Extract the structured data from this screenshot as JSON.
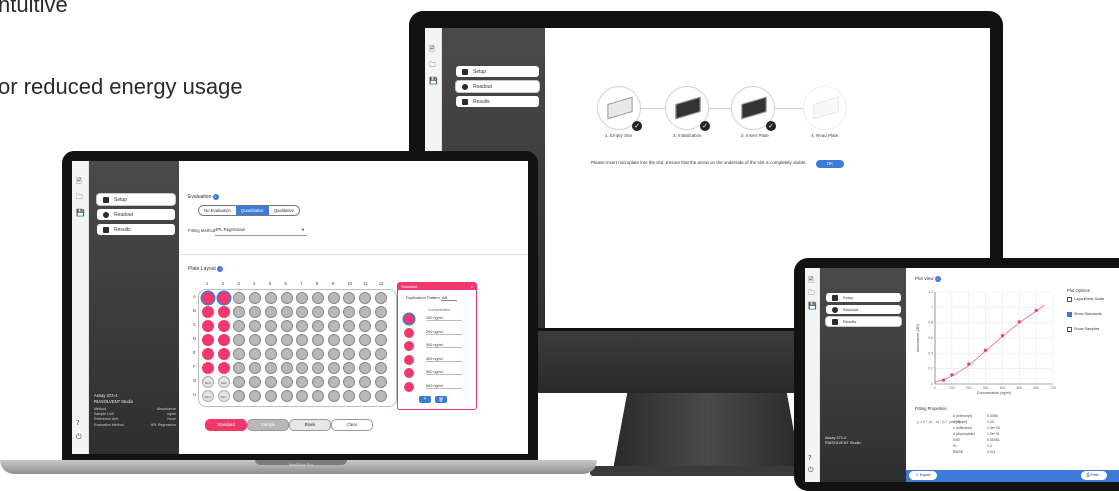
{
  "marketing": {
    "line1": "ntuitive",
    "line2": "or reduced energy usage"
  },
  "app": {
    "nav_items": [
      "Setup",
      "Readout",
      "Results"
    ],
    "info_panel": {
      "assay": "Assay 372-4",
      "software": "RIASOLVENT Studio",
      "rows": [
        {
          "label": "Method",
          "value": "Absorbance"
        },
        {
          "label": "Sample Unit",
          "value": "ng/ml"
        },
        {
          "label": "Reference Unit",
          "value": "None"
        },
        {
          "label": "Evaluation Method",
          "value": "4PL Regression"
        }
      ]
    }
  },
  "imac": {
    "steps": [
      "1. Empty Slot",
      "2. Initialization",
      "3. Insert Plate",
      "4. Read Plate"
    ],
    "instruction": "Please insert microplate into the slot. Ensure that the arrow on the underside of the slot is completely visible.",
    "ok_label": "OK"
  },
  "macbook": {
    "evaluation_title": "Evaluation",
    "evaluation_options": [
      "No Evaluation",
      "Quantitative",
      "Qualitative"
    ],
    "evaluation_selected": 1,
    "fitting_label": "Fitting Method",
    "fitting_value": "4PL Regression",
    "plate_title": "Plate Layout",
    "columns": [
      "1",
      "2",
      "3",
      "4",
      "5",
      "6",
      "7",
      "8",
      "9",
      "10",
      "11",
      "12"
    ],
    "rows": [
      "A",
      "B",
      "C",
      "D",
      "E",
      "F",
      "G",
      "H"
    ],
    "blank_label": "BLK",
    "std_label": "St",
    "popup": {
      "title": "Standard",
      "duplication_label": "Duplication Pattern",
      "duplication_value": "AB",
      "concentration_header": "Concentration",
      "entries": [
        "100 ng/ml",
        "200 ng/ml",
        "300 ng/ml",
        "400 ng/ml",
        "500 ng/ml",
        "600 ng/ml"
      ]
    },
    "bottom_buttons": [
      "Standard",
      "Sample",
      "Blank",
      "Clear"
    ],
    "device_label": "MacBook Pro"
  },
  "ipad": {
    "plot_title": "Plot View",
    "plot_options_title": "Plot Options",
    "options": [
      {
        "label": "Logarithmic Scale",
        "checked": false
      },
      {
        "label": "Show Standards",
        "checked": true
      },
      {
        "label": "Show Samples",
        "checked": false
      }
    ],
    "x_label": "Concentration (ng/ml)",
    "y_label": "Absorbance (OD)",
    "fit_title": "Fitting Properties",
    "fit_rows": [
      {
        "k": "a (Intercept)",
        "v": "0.0356"
      },
      {
        "k": "b (Slope)",
        "v": "1.03"
      },
      {
        "k": "c (Inflection)",
        "v": "1.3e+03"
      },
      {
        "k": "d (Asymptote)",
        "v": "1.0e+01"
      },
      {
        "k": "SSE",
        "v": "0.00051"
      },
      {
        "k": "R²",
        "v": "1.0"
      },
      {
        "k": "RMSE",
        "v": "0.011"
      }
    ],
    "export_label": "Export",
    "print_label": "Print..."
  },
  "chart_data": {
    "type": "scatter",
    "xlabel": "Concentration (ng/ml)",
    "ylabel": "Absorbance (OD)",
    "xlim": [
      0,
      700
    ],
    "ylim": [
      0,
      1.2
    ],
    "x_ticks": [
      0,
      100,
      200,
      300,
      400,
      500,
      600,
      700
    ],
    "y_ticks": [
      0,
      0.2,
      0.4,
      0.6,
      0.8,
      1.0,
      1.2
    ],
    "series": [
      {
        "type": "scatter",
        "x": [
          50,
          100,
          200,
          300,
          400,
          500,
          600
        ],
        "y": [
          0.05,
          0.12,
          0.26,
          0.44,
          0.63,
          0.81,
          0.96
        ]
      }
    ],
    "fit_curve_x": [
      0,
      100,
      200,
      300,
      400,
      500,
      600,
      650
    ],
    "fit_curve_y": [
      0.02,
      0.1,
      0.24,
      0.43,
      0.62,
      0.8,
      0.95,
      1.03
    ],
    "grid": true
  },
  "colors": {
    "accent_pink": "#f0386b",
    "accent_blue": "#3d7bd8",
    "nav_dark": "#3a3a3a"
  }
}
